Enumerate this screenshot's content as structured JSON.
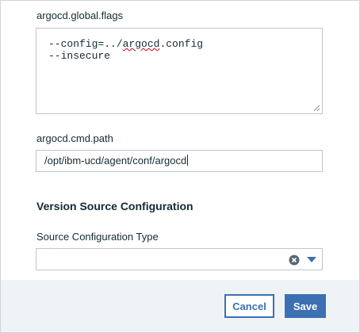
{
  "flags_field": {
    "label": "argocd.global.flags",
    "value_line1_prefix": "--config=../",
    "value_line1_misspelled": "argocd",
    "value_line1_suffix": ".config",
    "value_line2": "--insecure"
  },
  "path_field": {
    "label": "argocd.cmd.path",
    "value": "/opt/ibm-ucd/agent/conf/argocd"
  },
  "version_section": {
    "heading": "Version Source Configuration",
    "source_type_label": "Source Configuration Type",
    "source_type_value": ""
  },
  "footer": {
    "cancel_label": "Cancel",
    "save_label": "Save"
  },
  "icons": {
    "clear": "clear-circle-icon",
    "dropdown": "caret-down-icon",
    "resize": "resize-grip-icon"
  },
  "colors": {
    "primary": "#3d70b2",
    "footer_bg": "#f0f3f6",
    "border": "#c0c6cc",
    "text": "#152935",
    "spellcheck": "#d0021b"
  }
}
